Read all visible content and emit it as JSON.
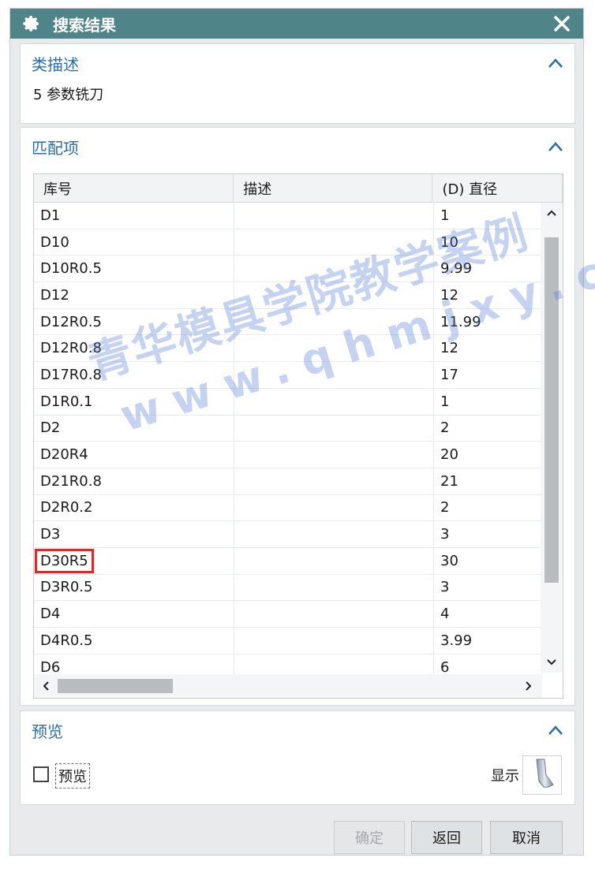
{
  "window": {
    "title": "搜索结果"
  },
  "class_panel": {
    "header": "类描述",
    "value": "5 参数铣刀"
  },
  "match_panel": {
    "header": "匹配项",
    "columns": [
      "库号",
      "描述",
      "(D) 直径"
    ],
    "rows": [
      {
        "id": "D1",
        "desc": "",
        "dia": "1"
      },
      {
        "id": "D10",
        "desc": "",
        "dia": "10"
      },
      {
        "id": "D10R0.5",
        "desc": "",
        "dia": "9.99"
      },
      {
        "id": "D12",
        "desc": "",
        "dia": "12"
      },
      {
        "id": "D12R0.5",
        "desc": "",
        "dia": "11.99"
      },
      {
        "id": "D12R0.8",
        "desc": "",
        "dia": "12"
      },
      {
        "id": "D17R0.8",
        "desc": "",
        "dia": "17"
      },
      {
        "id": "D1R0.1",
        "desc": "",
        "dia": "1"
      },
      {
        "id": "D2",
        "desc": "",
        "dia": "2"
      },
      {
        "id": "D20R4",
        "desc": "",
        "dia": "20"
      },
      {
        "id": "D21R0.8",
        "desc": "",
        "dia": "21"
      },
      {
        "id": "D2R0.2",
        "desc": "",
        "dia": "2"
      },
      {
        "id": "D3",
        "desc": "",
        "dia": "3"
      },
      {
        "id": "D30R5",
        "desc": "",
        "dia": "30"
      },
      {
        "id": "D3R0.5",
        "desc": "",
        "dia": "3"
      },
      {
        "id": "D4",
        "desc": "",
        "dia": "4"
      },
      {
        "id": "D4R0.5",
        "desc": "",
        "dia": "3.99"
      },
      {
        "id": "D6",
        "desc": "",
        "dia": "6"
      }
    ],
    "highlighted_row": "D30R5"
  },
  "preview_panel": {
    "header": "预览",
    "checkbox_label": "预览",
    "checkbox_checked": false,
    "show_label": "显示"
  },
  "buttons": {
    "ok": "确定",
    "back": "返回",
    "cancel": "取消"
  },
  "watermark": {
    "line1": "青华模具学院教学案例",
    "line2": "www.qhmjxy.com"
  },
  "colors": {
    "titlebar": "#4f8489",
    "section_header": "#2b6ea8",
    "highlight": "#d62b2b"
  },
  "icons": {
    "title": "gear-icon",
    "close": "close-icon",
    "collapse": "chevron-up-icon",
    "show": "tool-shape-icon"
  }
}
